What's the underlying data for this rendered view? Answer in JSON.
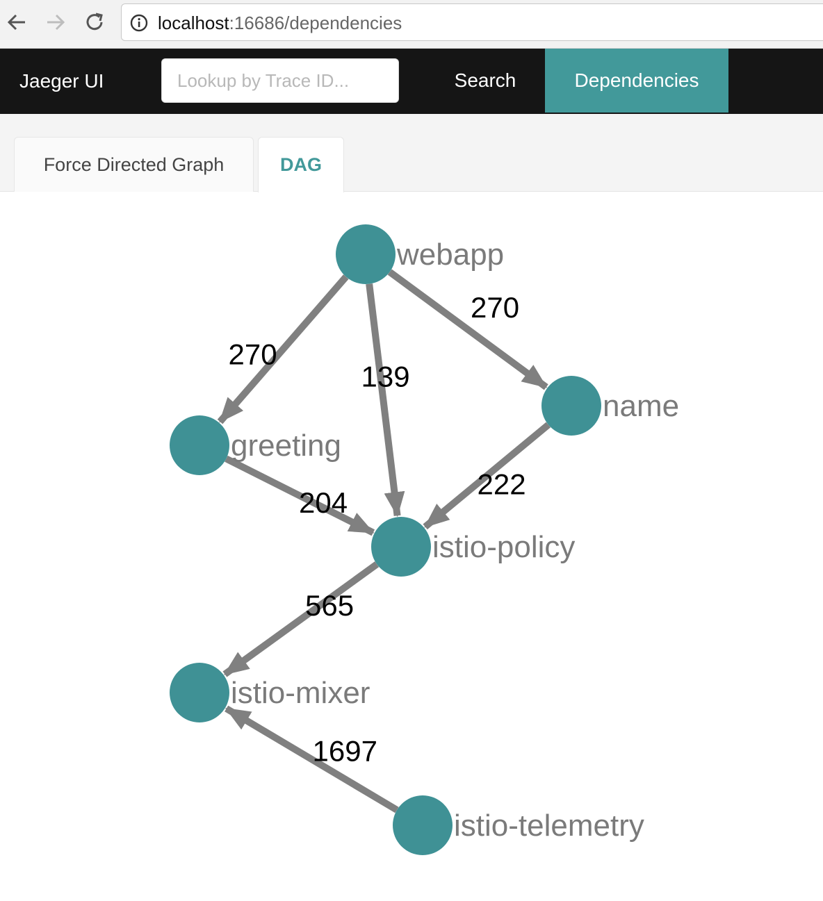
{
  "browser": {
    "url_host": "localhost",
    "url_rest": ":16686/dependencies",
    "icons": [
      "back-arrow-icon",
      "forward-arrow-icon",
      "reload-icon",
      "info-icon"
    ]
  },
  "header": {
    "brand": "Jaeger UI",
    "lookup_placeholder": "Lookup by Trace ID...",
    "nav": {
      "search": "Search",
      "dependencies": "Dependencies"
    },
    "accent_color": "#42999a"
  },
  "tabs": {
    "force": "Force Directed Graph",
    "dag": "DAG",
    "active": "DAG"
  },
  "graph": {
    "node_color": "#3f9195",
    "edge_color": "#808080",
    "nodes": [
      {
        "id": "webapp",
        "label": "webapp"
      },
      {
        "id": "greeting",
        "label": "greeting"
      },
      {
        "id": "name",
        "label": "name"
      },
      {
        "id": "istio-policy",
        "label": "istio-policy"
      },
      {
        "id": "istio-mixer",
        "label": "istio-mixer"
      },
      {
        "id": "istio-telemetry",
        "label": "istio-telemetry"
      }
    ],
    "edges": [
      {
        "source": "webapp",
        "target": "greeting",
        "count": "270"
      },
      {
        "source": "webapp",
        "target": "istio-policy",
        "count": "139"
      },
      {
        "source": "webapp",
        "target": "name",
        "count": "270"
      },
      {
        "source": "greeting",
        "target": "istio-policy",
        "count": "204"
      },
      {
        "source": "name",
        "target": "istio-policy",
        "count": "222"
      },
      {
        "source": "istio-policy",
        "target": "istio-mixer",
        "count": "565"
      },
      {
        "source": "istio-telemetry",
        "target": "istio-mixer",
        "count": "1697"
      }
    ]
  }
}
